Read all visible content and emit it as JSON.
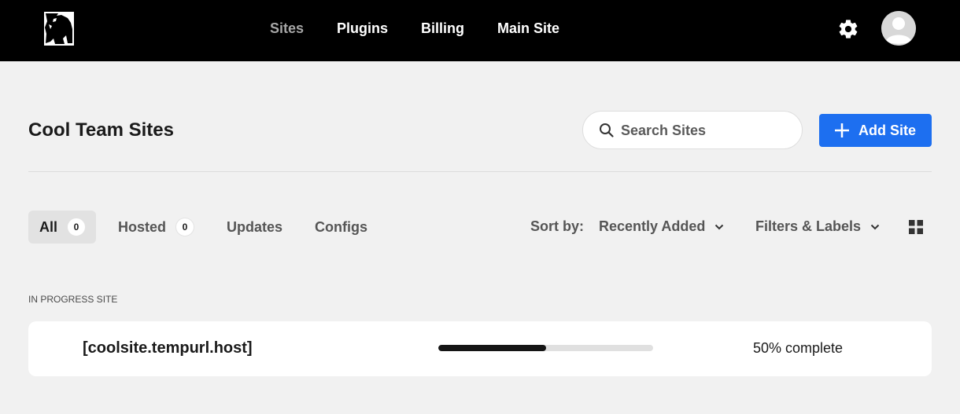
{
  "nav": {
    "items": [
      {
        "label": "Sites",
        "active": true
      },
      {
        "label": "Plugins",
        "active": false
      },
      {
        "label": "Billing",
        "active": false
      },
      {
        "label": "Main Site",
        "active": false
      }
    ]
  },
  "header": {
    "title": "Cool Team Sites",
    "search_placeholder": "Search Sites",
    "add_label": "Add Site"
  },
  "tabs": [
    {
      "label": "All",
      "count": "0",
      "active": true
    },
    {
      "label": "Hosted",
      "count": "0",
      "active": false
    },
    {
      "label": "Updates",
      "active": false
    },
    {
      "label": "Configs",
      "active": false
    }
  ],
  "controls": {
    "sort_label": "Sort by:",
    "sort_value": "Recently Added",
    "filters_label": "Filters & Labels"
  },
  "in_progress": {
    "section_label": "IN PROGRESS SITE",
    "site_name": "[coolsite.tempurl.host]",
    "progress": 0.5,
    "progress_text": "50% complete"
  },
  "colors": {
    "topbar": "#000000",
    "accent": "#1d6ff0",
    "background": "#f1f1f1",
    "nav_active": "#a7a7a7"
  },
  "icons": [
    "gorilla-logo-icon",
    "gear-icon",
    "avatar-icon",
    "search-icon",
    "plus-icon",
    "chevron-down-icon",
    "grid-view-icon"
  ]
}
